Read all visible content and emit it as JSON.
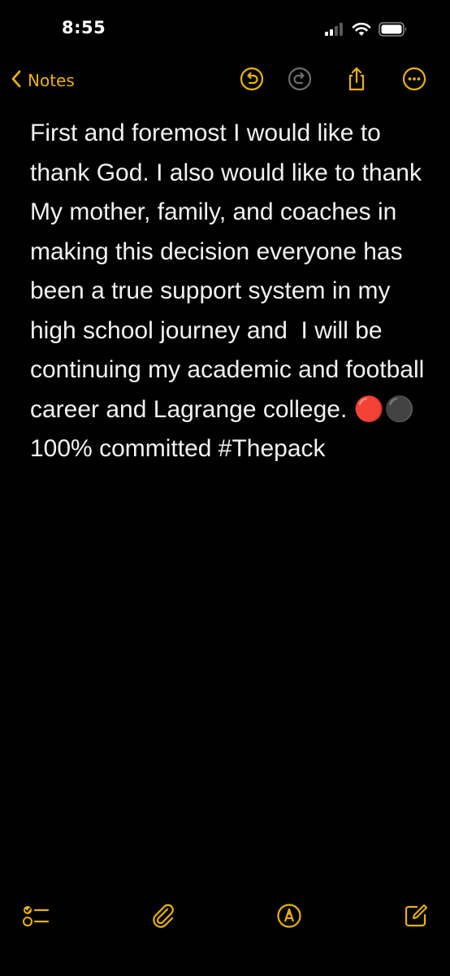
{
  "status_bar": {
    "time": "8:55",
    "icons": [
      "cellular-signal-icon",
      "wifi-icon",
      "battery-icon"
    ]
  },
  "toolbar": {
    "back_label": "Notes",
    "icons": [
      "chevron-left-icon",
      "undo-icon",
      "redo-icon",
      "share-icon",
      "more-icon"
    ]
  },
  "note": {
    "body": "First and foremost I would like to thank God. I also would like to thank My mother, family, and coaches in making this decision everyone has been a true support system in my high school journey and  I will be continuing my academic and football career and Lagrange college. 🔴⚫️ 100% committed #Thepack"
  },
  "bottom_bar": {
    "icons": [
      "checklist-icon",
      "paperclip-icon",
      "markup-pen-icon",
      "compose-icon"
    ]
  },
  "colors": {
    "background": "#000000",
    "accent": "#e9b10a",
    "text": "#f2f2f2",
    "disabled": "#6b6b6b"
  }
}
